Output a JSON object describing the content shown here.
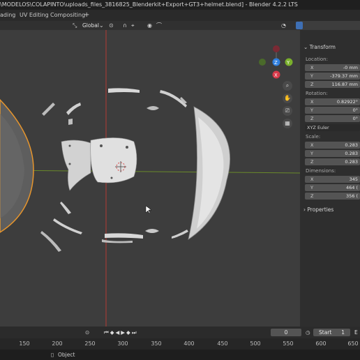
{
  "window": {
    "title": "\\MODELOS\\COLAPINTO\\uploads_files_3816825_Blenderkit+Export+GT3+helmet.blend] - Blender 4.2.2 LTS"
  },
  "menubar": {
    "tabs": [
      "ading",
      "UV Editing",
      "Compositing"
    ],
    "add_tab": "+"
  },
  "toolbar": {
    "transform_orientation": "Global"
  },
  "viewport": {
    "gizmo": {
      "z": "Z",
      "y": "Y",
      "x": "X"
    }
  },
  "npanel": {
    "transform_header": "Transform",
    "location": {
      "label": "Location:",
      "x": {
        "axis": "X",
        "value": "-0 mm"
      },
      "y": {
        "axis": "Y",
        "value": "-379.37 mm"
      },
      "z": {
        "axis": "Z",
        "value": "116.87 mm"
      }
    },
    "rotation": {
      "label": "Rotation:",
      "x": {
        "axis": "X",
        "value": "0.82922°"
      },
      "y": {
        "axis": "Y",
        "value": "0°"
      },
      "z": {
        "axis": "Z",
        "value": "0°"
      },
      "mode": "XYZ Euler"
    },
    "scale": {
      "label": "Scale:",
      "x": {
        "axis": "X",
        "value": "0.283"
      },
      "y": {
        "axis": "Y",
        "value": "0.283"
      },
      "z": {
        "axis": "Z",
        "value": "0.283"
      }
    },
    "dimensions": {
      "label": "Dimensions:",
      "x": {
        "axis": "X",
        "value": "345"
      },
      "y": {
        "axis": "Y",
        "value": "464 ("
      },
      "z": {
        "axis": "Z",
        "value": "356 ("
      }
    },
    "properties_header": "Properties"
  },
  "timeline": {
    "current_frame": "0",
    "start_label": "Start",
    "start_value": "1",
    "end_label": "E",
    "ruler_ticks": [
      "150",
      "200",
      "250",
      "300",
      "350",
      "400",
      "450",
      "500",
      "550",
      "600",
      "650"
    ]
  },
  "statusbar": {
    "mode": "Object"
  },
  "colors": {
    "viewport_bg": "#3d3d3d",
    "axis_red": "#c0392b",
    "axis_green": "#6a8a2a",
    "selection_orange": "#e6952d",
    "gizmo_x": "#d8394a",
    "gizmo_y": "#7ab02c",
    "gizmo_z": "#2f7fe0",
    "playhead_blue": "#3b7de0"
  }
}
